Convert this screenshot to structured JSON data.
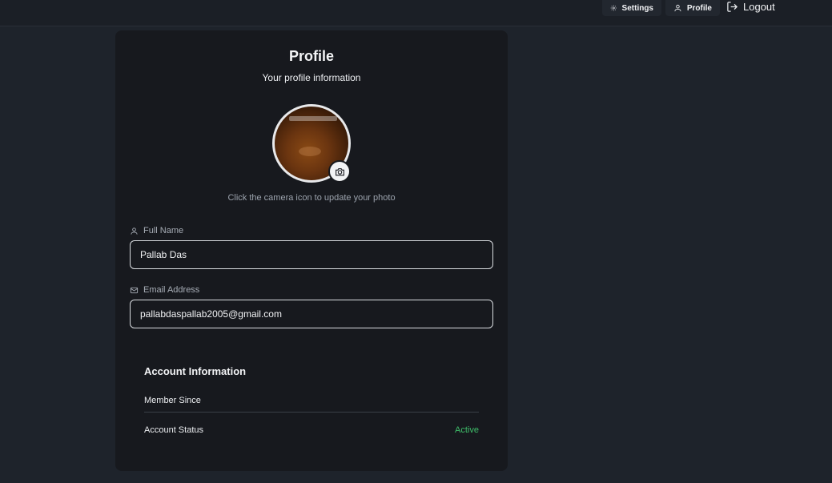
{
  "nav": {
    "settings_label": "Settings",
    "profile_label": "Profile",
    "logout_label": "Logout"
  },
  "profile": {
    "title": "Profile",
    "subtitle": "Your profile information",
    "photo_hint": "Click the camera icon to update your photo"
  },
  "form": {
    "full_name_label": "Full Name",
    "full_name_value": "Pallab Das",
    "email_label": "Email Address",
    "email_value": "pallabdaspallab2005@gmail.com"
  },
  "account": {
    "title": "Account Information",
    "member_since_label": "Member Since",
    "member_since_value": "",
    "status_label": "Account Status",
    "status_value": "Active"
  },
  "colors": {
    "background": "#1e232b",
    "card": "#17191e",
    "status_active": "#3fbf6a"
  },
  "icons": {
    "settings": "gear-icon",
    "profile": "user-icon",
    "logout": "logout-icon",
    "camera": "camera-icon",
    "name": "user-icon",
    "email": "mail-icon"
  }
}
